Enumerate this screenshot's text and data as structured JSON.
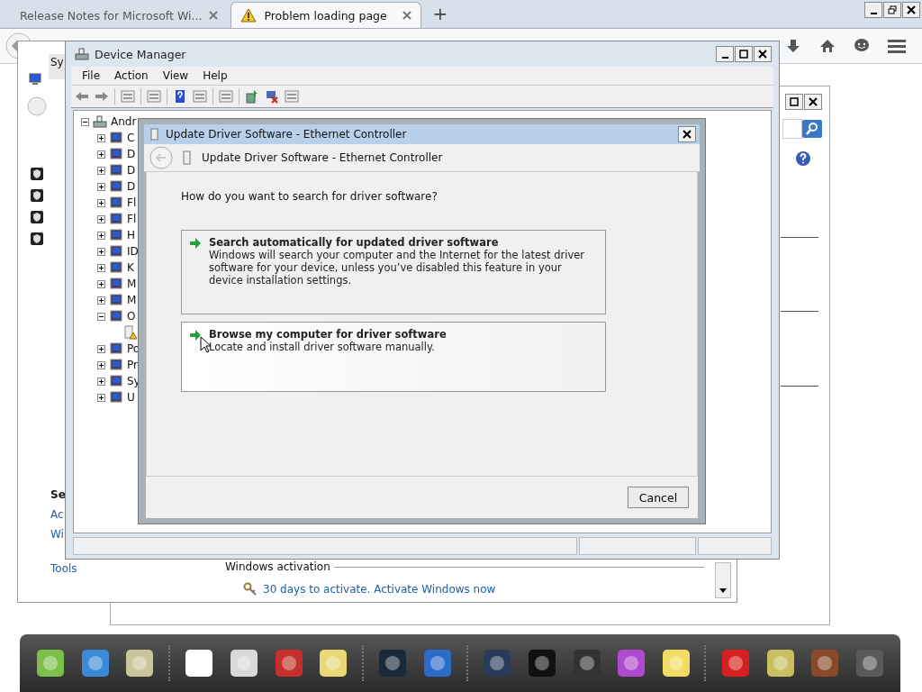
{
  "browser": {
    "tabs": [
      {
        "label": "Release Notes for Microsoft Wi...",
        "selected": false,
        "warning": false
      },
      {
        "label": "Problem loading page",
        "selected": true,
        "warning": true
      }
    ],
    "new_tab": "+"
  },
  "system_window": {
    "title": "Sy",
    "links_heading": "Se",
    "links": [
      "Ac",
      "Wi",
      "Tools"
    ],
    "activation_heading": "Windows activation",
    "activation_link": "30 days to activate. Activate Windows now"
  },
  "device_manager": {
    "title": "Device Manager",
    "menu": [
      "File",
      "Action",
      "View",
      "Help"
    ],
    "tree": {
      "label": "Andr",
      "expanded": true,
      "children": [
        {
          "label": "C",
          "expanded": false
        },
        {
          "label": "D",
          "expanded": false
        },
        {
          "label": "D",
          "expanded": false
        },
        {
          "label": "D",
          "expanded": false
        },
        {
          "label": "Fl",
          "expanded": false
        },
        {
          "label": "Fl",
          "expanded": false
        },
        {
          "label": "H",
          "expanded": false
        },
        {
          "label": "ID",
          "expanded": false
        },
        {
          "label": "K",
          "expanded": false
        },
        {
          "label": "M",
          "expanded": false
        },
        {
          "label": "M",
          "expanded": false
        },
        {
          "label": "O",
          "expanded": true,
          "children": [
            {
              "warning": true
            }
          ]
        },
        {
          "label": "Po",
          "expanded": false
        },
        {
          "label": "Pr",
          "expanded": false
        },
        {
          "label": "Sy",
          "expanded": false
        },
        {
          "label": "U",
          "expanded": false
        }
      ]
    }
  },
  "dialog": {
    "title": "Update Driver Software - Ethernet Controller",
    "header": "Update Driver Software - Ethernet Controller",
    "question": "How do you want to search for driver software?",
    "options": [
      {
        "title": "Search automatically for updated driver software",
        "description": "Windows will search your computer and the Internet for the latest driver software for your device, unless you’ve disabled this feature in your device installation settings.",
        "selected": false
      },
      {
        "title": "Browse my computer for driver software",
        "description": "Locate and install driver software manually.",
        "selected": true
      }
    ],
    "cancel": "Cancel"
  }
}
